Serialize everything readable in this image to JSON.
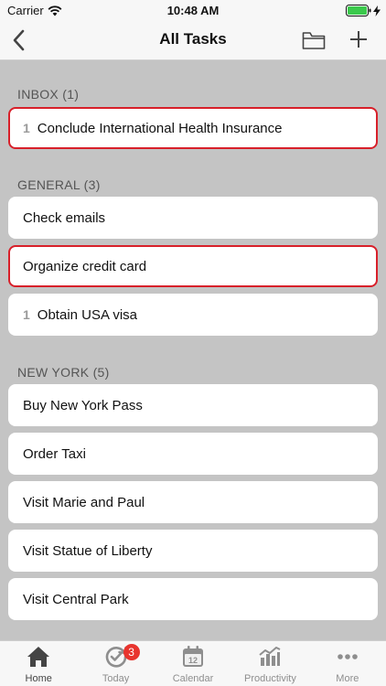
{
  "status_bar": {
    "carrier": "Carrier",
    "time": "10:48 AM"
  },
  "nav": {
    "title": "All Tasks"
  },
  "sections": [
    {
      "header": "INBOX (1)",
      "items": [
        {
          "count": "1",
          "label": "Conclude International Health Insurance",
          "flagged": true
        }
      ]
    },
    {
      "header": "GENERAL (3)",
      "items": [
        {
          "count": "",
          "label": "Check emails",
          "flagged": false
        },
        {
          "count": "",
          "label": "Organize credit card",
          "flagged": true
        },
        {
          "count": "1",
          "label": "Obtain USA visa",
          "flagged": false
        }
      ]
    },
    {
      "header": "NEW YORK (5)",
      "items": [
        {
          "count": "",
          "label": "Buy New York Pass",
          "flagged": false
        },
        {
          "count": "",
          "label": "Order Taxi",
          "flagged": false
        },
        {
          "count": "",
          "label": "Visit Marie and Paul",
          "flagged": false
        },
        {
          "count": "",
          "label": "Visit Statue of Liberty",
          "flagged": false
        },
        {
          "count": "",
          "label": "Visit Central Park",
          "flagged": false
        }
      ]
    }
  ],
  "tabs": [
    {
      "label": "Home",
      "icon": "home-icon",
      "active": true
    },
    {
      "label": "Today",
      "icon": "today-icon",
      "badge": "3"
    },
    {
      "label": "Calendar",
      "icon": "calendar-icon",
      "icon_text": "12"
    },
    {
      "label": "Productivity",
      "icon": "productivity-icon"
    },
    {
      "label": "More",
      "icon": "more-icon"
    }
  ],
  "colors": {
    "flag_border": "#d8202a",
    "badge": "#e8342e",
    "background": "#c4c4c4"
  }
}
